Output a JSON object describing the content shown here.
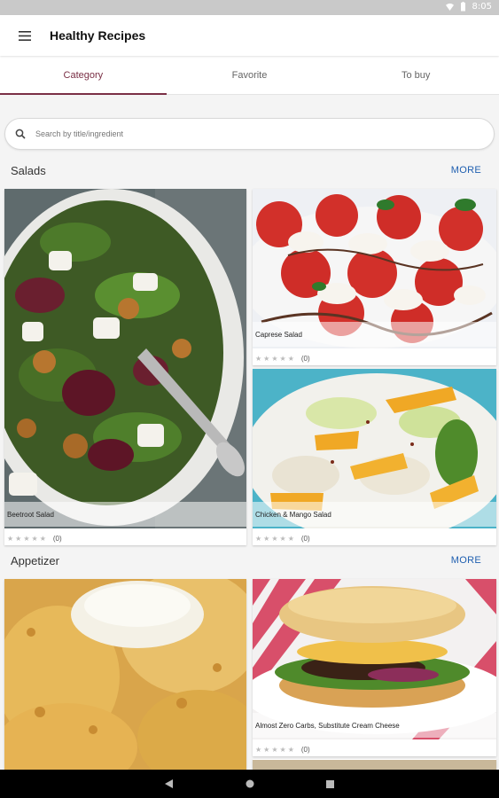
{
  "status_bar": {
    "time": "8:05"
  },
  "app_bar": {
    "title": "Healthy Recipes",
    "menu_icon": "hamburger-menu-icon"
  },
  "tabs": [
    {
      "label": "Category",
      "active": true
    },
    {
      "label": "Favorite",
      "active": false
    },
    {
      "label": "To buy",
      "active": false
    }
  ],
  "search": {
    "placeholder": "Search by title/ingredient"
  },
  "sections": [
    {
      "title": "Salads",
      "more_label": "MORE",
      "cards": [
        {
          "name": "Beetroot Salad",
          "rating_count": "(0)",
          "stars": 0
        },
        {
          "name": "Caprese Salad",
          "rating_count": "(0)",
          "stars": 0
        },
        {
          "name": "Chicken & Mango Salad",
          "rating_count": "(0)",
          "stars": 0
        }
      ]
    },
    {
      "title": "Appetizer",
      "more_label": "MORE",
      "cards": [
        {
          "name": "",
          "rating_count": "",
          "stars": 0
        },
        {
          "name": "Almost Zero Carbs, Substitute Cream Cheese",
          "rating_count": "(0)",
          "stars": 0
        }
      ]
    }
  ],
  "colors": {
    "accent": "#7a2f45",
    "link": "#1f5fb0"
  }
}
